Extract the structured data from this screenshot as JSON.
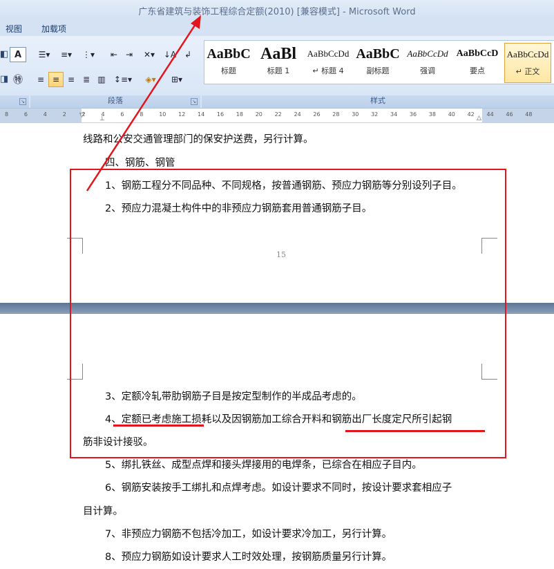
{
  "window": {
    "title": "广东省建筑与装饰工程综合定额(2010) [兼容模式] - Microsoft Word"
  },
  "tabs": [
    "视图",
    "加载项"
  ],
  "ribbon": {
    "paragraph_label": "段落",
    "styles_label": "样式",
    "styles": [
      {
        "sample": "AaBbC",
        "name": "标题"
      },
      {
        "sample": "AaBl",
        "name": "标题 1"
      },
      {
        "sample": "AaBbCcDd",
        "name": "↵ 标题 4"
      },
      {
        "sample": "AaBbC",
        "name": "副标题"
      },
      {
        "sample": "AaBbCcDd",
        "name": "强调"
      },
      {
        "sample": "AaBbCcD",
        "name": "要点"
      },
      {
        "sample": "AaBbCcDd",
        "name": "↵ 正文"
      }
    ]
  },
  "ruler": {
    "labels": [
      "8",
      "6",
      "4",
      "2",
      "2",
      "4",
      "6",
      "8",
      "10",
      "12",
      "14",
      "16",
      "18",
      "20",
      "22",
      "24",
      "26",
      "28",
      "30",
      "32",
      "34",
      "36",
      "38",
      "40",
      "42",
      "44",
      "46",
      "48"
    ]
  },
  "document": {
    "page1": [
      "线路和公安交通管理部门的保安护送费，另行计算。",
      "四、钢筋、钢管",
      "1、钢筋工程分不同品种、不同规格，按普通钢筋、预应力钢筋等分别设列子目。",
      "2、预应力混凝土构件中的非预应力钢筋套用普通钢筋子目。"
    ],
    "page_number": "15",
    "page2": [
      "3、定额冷轧带肋钢筋子目是按定型制作的半成品考虑的。",
      "4、定额已考虑施工损耗以及因钢筋加工综合开料和钢筋出厂长度定尺所引起钢",
      "筋非设计接驳。",
      "5、绑扎铁丝、成型点焊和接头焊接用的电焊条，已综合在相应子目内。",
      "6、钢筋安装按手工绑扎和点焊考虑。如设计要求不同时，按设计要求套相应子",
      "目计算。",
      "7、非预应力钢筋不包括冷加工，如设计要求冷加工，另行计算。",
      "8、预应力钢筋如设计要求人工时效处理，按钢筋质量另行计算。"
    ]
  },
  "annotation_color": "#e3141c"
}
